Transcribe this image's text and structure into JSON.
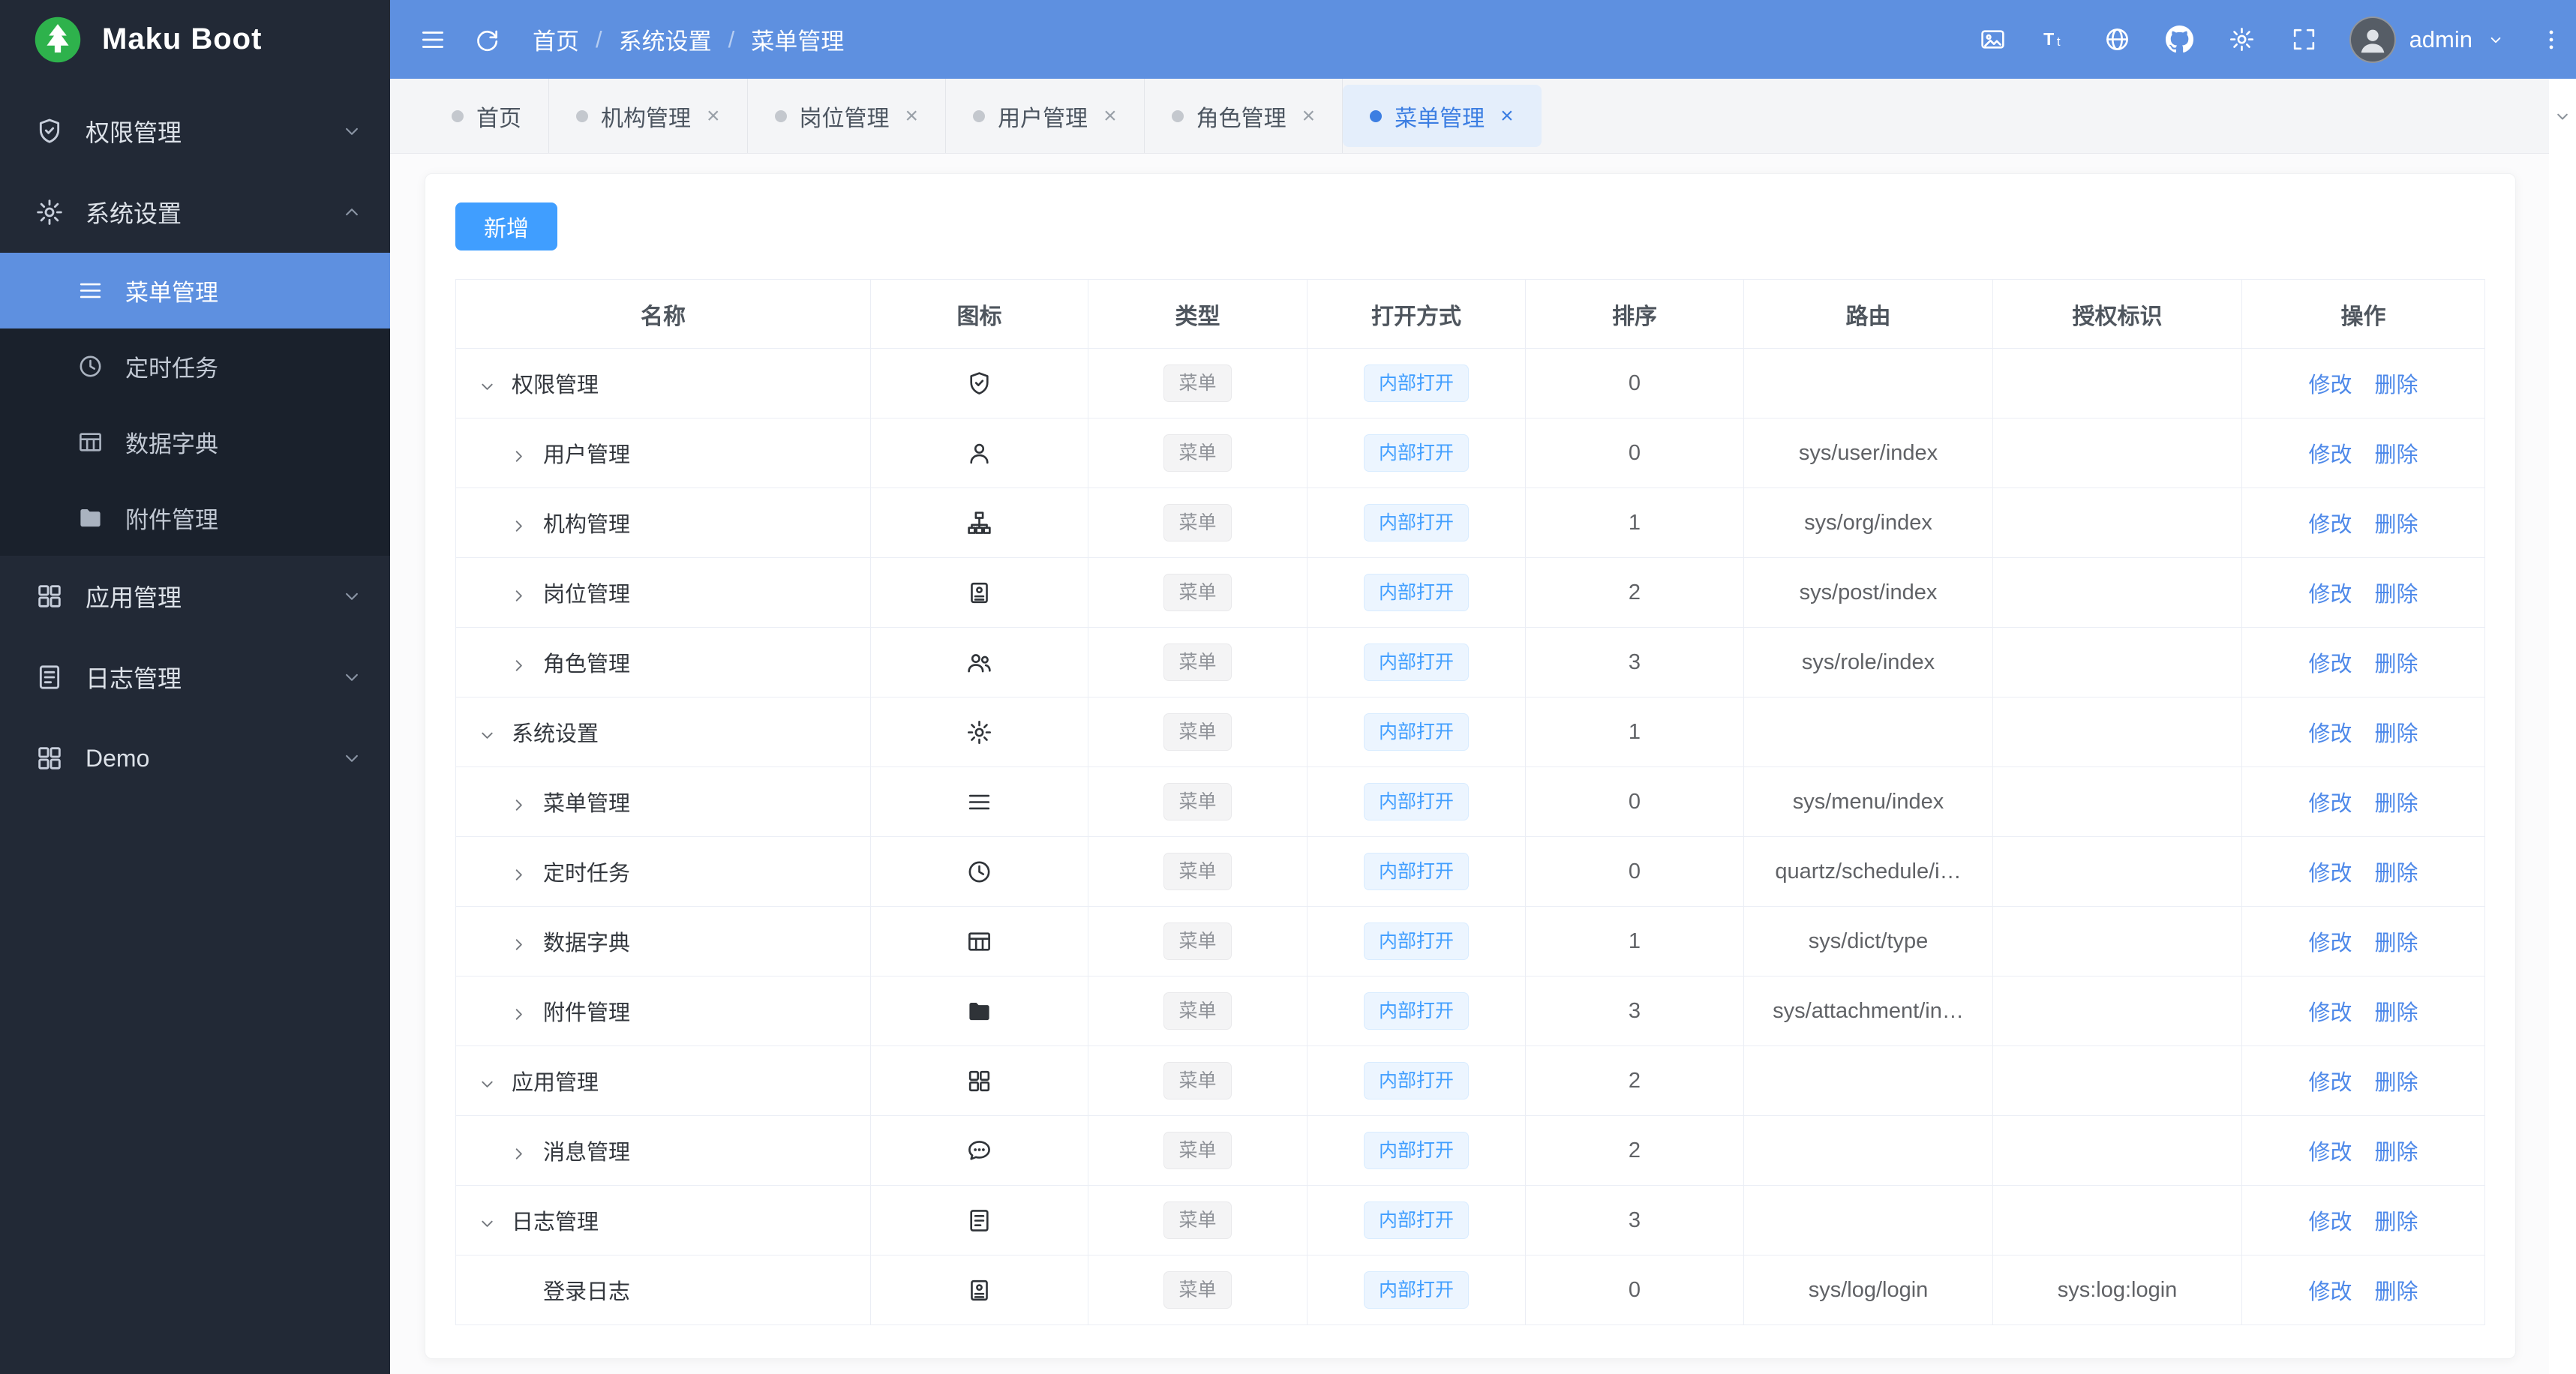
{
  "app": {
    "name": "Maku Boot"
  },
  "colors": {
    "header_blue": "#5e90e0",
    "sidebar_bg": "#222936",
    "sidebar_submenu_bg": "#1a212c",
    "active_item_blue": "#5e90e0",
    "primary": "#409eff",
    "link": "#4e89e9",
    "active_tab_bg": "#e4eefb",
    "active_tab_text": "#3c7ee2",
    "logo_green": "#2eb24c",
    "table_border": "#ebeef5"
  },
  "header": {
    "left_icons": [
      {
        "name": "collapse-sidebar-icon",
        "glyph": "hamburger"
      },
      {
        "name": "refresh-icon",
        "glyph": "refresh"
      }
    ],
    "breadcrumb": [
      "首页",
      "系统设置",
      "菜单管理"
    ],
    "separator": "/",
    "right_icons": [
      {
        "name": "screenshot-icon",
        "glyph": "image"
      },
      {
        "name": "font-size-icon",
        "glyph": "font-size"
      },
      {
        "name": "language-icon",
        "glyph": "globe"
      },
      {
        "name": "github-icon",
        "glyph": "github"
      },
      {
        "name": "theme-icon",
        "glyph": "gear"
      },
      {
        "name": "fullscreen-icon",
        "glyph": "fullscreen"
      }
    ],
    "user": "admin"
  },
  "sidebar": {
    "menu": [
      {
        "label": "权限管理",
        "icon": "shield",
        "expanded": false
      },
      {
        "label": "系统设置",
        "icon": "gear",
        "expanded": true,
        "children": [
          {
            "label": "菜单管理",
            "icon": "menu",
            "active": true
          },
          {
            "label": "定时任务",
            "icon": "clock",
            "active": false
          },
          {
            "label": "数据字典",
            "icon": "dict",
            "active": false
          },
          {
            "label": "附件管理",
            "icon": "folder",
            "active": false
          }
        ]
      },
      {
        "label": "应用管理",
        "icon": "apps",
        "expanded": false
      },
      {
        "label": "日志管理",
        "icon": "log",
        "expanded": false
      },
      {
        "label": "Demo",
        "icon": "apps",
        "expanded": false
      }
    ]
  },
  "tabs": [
    {
      "label": "首页",
      "closable": false,
      "active": false
    },
    {
      "label": "机构管理",
      "closable": true,
      "active": false
    },
    {
      "label": "岗位管理",
      "closable": true,
      "active": false
    },
    {
      "label": "用户管理",
      "closable": true,
      "active": false
    },
    {
      "label": "角色管理",
      "closable": true,
      "active": false
    },
    {
      "label": "菜单管理",
      "closable": true,
      "active": true
    }
  ],
  "toolbar": {
    "add_label": "新增"
  },
  "table": {
    "columns": [
      "名称",
      "图标",
      "类型",
      "打开方式",
      "排序",
      "路由",
      "授权标识",
      "操作"
    ],
    "tag_type": "菜单",
    "tag_open": "内部打开",
    "actions": {
      "edit": "修改",
      "delete": "删除"
    },
    "rows": [
      {
        "name": "权限管理",
        "level": 0,
        "expand": "open",
        "icon": "shield",
        "sort": "0",
        "route": "",
        "auth": ""
      },
      {
        "name": "用户管理",
        "level": 1,
        "expand": "closed",
        "icon": "user",
        "sort": "0",
        "route": "sys/user/index",
        "auth": ""
      },
      {
        "name": "机构管理",
        "level": 1,
        "expand": "closed",
        "icon": "org",
        "sort": "1",
        "route": "sys/org/index",
        "auth": ""
      },
      {
        "name": "岗位管理",
        "level": 1,
        "expand": "closed",
        "icon": "post",
        "sort": "2",
        "route": "sys/post/index",
        "auth": ""
      },
      {
        "name": "角色管理",
        "level": 1,
        "expand": "closed",
        "icon": "role",
        "sort": "3",
        "route": "sys/role/index",
        "auth": ""
      },
      {
        "name": "系统设置",
        "level": 0,
        "expand": "open",
        "icon": "gear",
        "sort": "1",
        "route": "",
        "auth": ""
      },
      {
        "name": "菜单管理",
        "level": 1,
        "expand": "closed",
        "icon": "menu",
        "sort": "0",
        "route": "sys/menu/index",
        "auth": ""
      },
      {
        "name": "定时任务",
        "level": 1,
        "expand": "closed",
        "icon": "clock",
        "sort": "0",
        "route": "quartz/schedule/i…",
        "auth": ""
      },
      {
        "name": "数据字典",
        "level": 1,
        "expand": "closed",
        "icon": "dict",
        "sort": "1",
        "route": "sys/dict/type",
        "auth": ""
      },
      {
        "name": "附件管理",
        "level": 1,
        "expand": "closed",
        "icon": "folder",
        "sort": "3",
        "route": "sys/attachment/in…",
        "auth": ""
      },
      {
        "name": "应用管理",
        "level": 0,
        "expand": "open",
        "icon": "apps",
        "sort": "2",
        "route": "",
        "auth": ""
      },
      {
        "name": "消息管理",
        "level": 1,
        "expand": "closed",
        "icon": "message",
        "sort": "2",
        "route": "",
        "auth": ""
      },
      {
        "name": "日志管理",
        "level": 0,
        "expand": "open",
        "icon": "log",
        "sort": "3",
        "route": "",
        "auth": ""
      },
      {
        "name": "登录日志",
        "level": 1,
        "expand": "none",
        "icon": "post",
        "sort": "0",
        "route": "sys/log/login",
        "auth": "sys:log:login"
      }
    ]
  }
}
